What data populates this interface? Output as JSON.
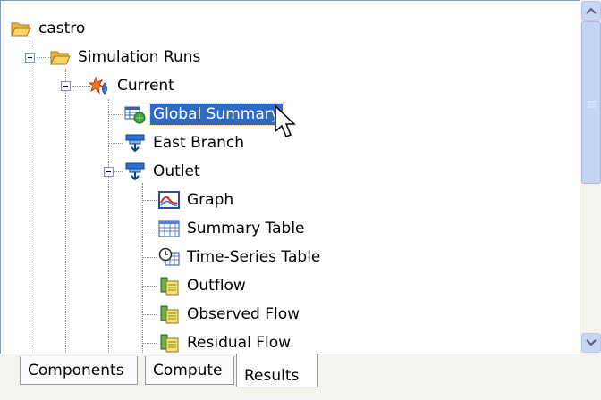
{
  "tree": {
    "items": [
      {
        "label": "castro",
        "icon": "folder-open-icon"
      },
      {
        "label": "Simulation Runs",
        "icon": "folder-open-icon"
      },
      {
        "label": "Current",
        "icon": "simulation-run-icon"
      },
      {
        "label": "Global Summary",
        "icon": "global-summary-icon",
        "selected": true
      },
      {
        "label": "East Branch",
        "icon": "reach-element-icon"
      },
      {
        "label": "Outlet",
        "icon": "junction-element-icon"
      },
      {
        "label": "Graph",
        "icon": "graph-icon"
      },
      {
        "label": "Summary Table",
        "icon": "summary-table-icon"
      },
      {
        "label": "Time-Series Table",
        "icon": "time-series-table-icon"
      },
      {
        "label": "Outflow",
        "icon": "time-series-data-icon"
      },
      {
        "label": "Observed Flow",
        "icon": "time-series-data-icon"
      },
      {
        "label": "Residual Flow",
        "icon": "time-series-data-icon"
      }
    ]
  },
  "scrollbar": {
    "up_icon": "chevron-up-icon",
    "down_icon": "chevron-down-icon"
  },
  "tabs": [
    {
      "label": "Components"
    },
    {
      "label": "Compute"
    },
    {
      "label": "Results",
      "active": true
    }
  ],
  "colors": {
    "selection": "#316ac5",
    "tab_border": "#919b9c",
    "scroll_button": "#c8d6f4"
  }
}
